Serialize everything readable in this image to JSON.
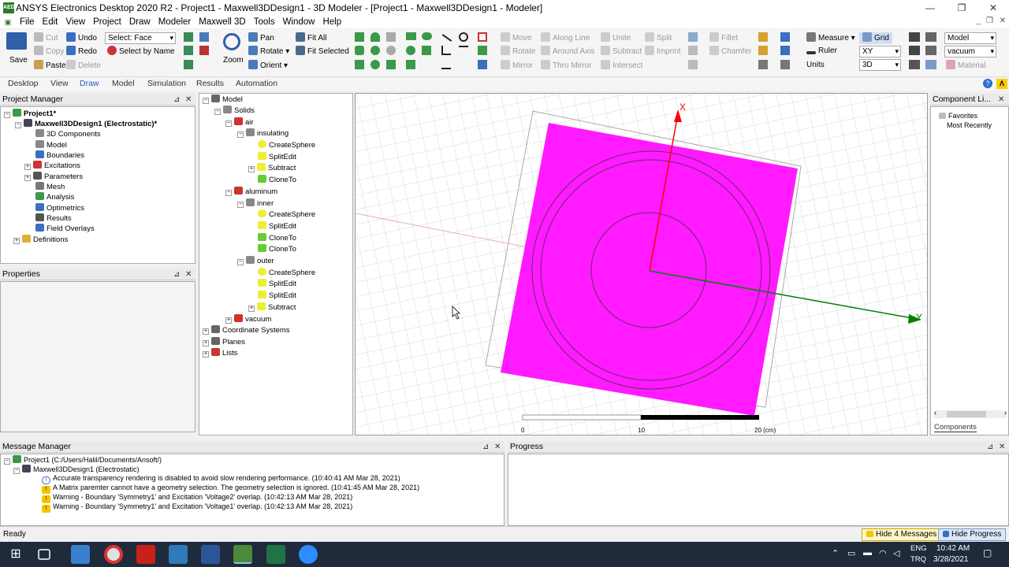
{
  "window": {
    "title": "ANSYS Electronics Desktop 2020 R2 - Project1 - Maxwell3DDesign1 - 3D Modeler - [Project1 - Maxwell3DDesign1 - Modeler]",
    "app_icon": "AEDT"
  },
  "menu": [
    "File",
    "Edit",
    "View",
    "Project",
    "Draw",
    "Modeler",
    "Maxwell 3D",
    "Tools",
    "Window",
    "Help"
  ],
  "ribbon": {
    "save": "Save",
    "cut": "Cut",
    "copy": "Copy",
    "paste": "Paste",
    "undo": "Undo",
    "redo": "Redo",
    "delete": "Delete",
    "select_mode": "Select: Face",
    "select_by_name": "Select by Name",
    "zoom": "Zoom",
    "pan": "Pan",
    "rotate": "Rotate",
    "orient": "Orient",
    "fit_all": "Fit All",
    "fit_selected": "Fit Selected",
    "move": "Move",
    "rotate2": "Rotate",
    "mirror": "Mirror",
    "along_line": "Along Line",
    "around_axis": "Around Axis",
    "thru_mirror": "Thru Mirror",
    "unite": "Unite",
    "subtract": "Subtract",
    "intersect": "Intersect",
    "split": "Split",
    "imprint": "Imprint",
    "fillet": "Fillet",
    "chamfer": "Chamfer",
    "measure": "Measure",
    "ruler": "Ruler",
    "units": "Units",
    "grid": "Grid",
    "plane": "XY",
    "dim": "3D",
    "material_model": "Model",
    "material_name": "vacuum",
    "material": "Material"
  },
  "tabs": [
    "Desktop",
    "View",
    "Draw",
    "Model",
    "Simulation",
    "Results",
    "Automation"
  ],
  "active_tab": "Draw",
  "project_manager": {
    "title": "Project Manager",
    "items": [
      "Project1*",
      "Maxwell3DDesign1 (Electrostatic)*",
      "3D Components",
      "Model",
      "Boundaries",
      "Excitations",
      "Parameters",
      "Mesh",
      "Analysis",
      "Optimetrics",
      "Results",
      "Field Overlays",
      "Definitions"
    ]
  },
  "properties": {
    "title": "Properties"
  },
  "model_tree": {
    "items": [
      "Model",
      "Solids",
      "air",
      "insulating",
      "CreateSphere",
      "SplitEdit",
      "Subtract",
      "CloneTo",
      "aluminum",
      "inner",
      "CreateSphere",
      "SplitEdit",
      "CloneTo",
      "CloneTo",
      "outer",
      "CreateSphere",
      "SplitEdit",
      "SplitEdit",
      "Subtract",
      "vacuum",
      "Coordinate Systems",
      "Planes",
      "Lists"
    ]
  },
  "viewport": {
    "axis_x": "X",
    "axis_y": "Y",
    "scale": [
      "0",
      "10",
      "20 (cm)"
    ],
    "colors": {
      "solid": "#ff1aff",
      "x_axis": "#ff0000",
      "y_axis": "#008000"
    }
  },
  "component_library": {
    "title": "Component Li...",
    "items": [
      "Favorites",
      "Most Recently"
    ],
    "tab": "Components"
  },
  "message_manager": {
    "title": "Message Manager",
    "project": "Project1 (C:/Users/Halil/Documents/Ansoft/)",
    "design": "Maxwell3DDesign1 (Electrostatic)",
    "messages": [
      "Accurate transparency rendering is disabled to avoid slow rendering performance. (10:40:41 AM  Mar 28, 2021)",
      "A Matrix paremter cannot have a geometry selection.  The geometry selection is ignored. (10:41:45 AM  Mar 28, 2021)",
      "Warning - Boundary 'Symmetry1' and Excitation 'Voltage2' overlap.  (10:42:13 AM  Mar 28, 2021)",
      "Warning - Boundary 'Symmetry1' and Excitation 'Voltage1' overlap.  (10:42:13 AM  Mar 28, 2021)"
    ]
  },
  "progress": {
    "title": "Progress"
  },
  "status": {
    "text": "Ready",
    "hide_messages": "Hide 4 Messages",
    "hide_progress": "Hide Progress"
  },
  "taskbar": {
    "lang": "ENG",
    "lang2": "TRQ",
    "time": "10:42 AM",
    "date": "3/28/2021"
  }
}
